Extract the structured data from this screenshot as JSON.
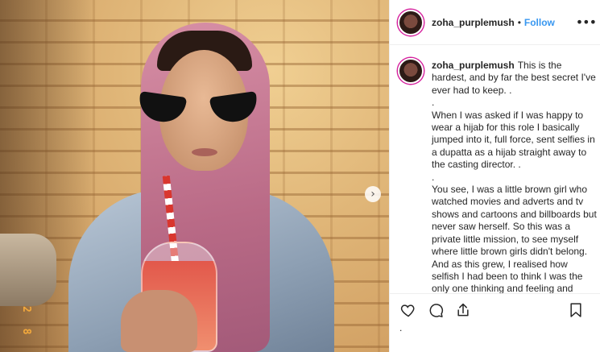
{
  "post": {
    "date_stamp": "2 8",
    "image_alt": "photo"
  },
  "header": {
    "username": "zoha_purplemush",
    "separator": "•",
    "follow_label": "Follow",
    "more_icon": "more-horizontal-icon"
  },
  "caption": {
    "username": "zoha_purplemush",
    "lines": [
      "This is the hardest, and by far the best secret I've ever had to keep. .",
      ".",
      "When I was asked if I was happy to wear a hijab for this role I basically jumped into it, full force, sent selfies in a dupatta as a hijab straight away to the casting director. .",
      ".",
      "You see, I was a little brown girl who watched movies and adverts and tv shows and cartoons and billboards but never saw herself. So this was a private little mission, to see myself where little brown girls didn't belong. And as this grew, I realised how selfish I had been to think I was the only one thinking and feeling and hoping the way I was. So this one's for all of us"
    ]
  },
  "actions": {
    "like_icon": "heart-icon",
    "comment_icon": "comment-icon",
    "share_icon": "share-icon",
    "save_icon": "bookmark-icon",
    "trailing": "."
  }
}
